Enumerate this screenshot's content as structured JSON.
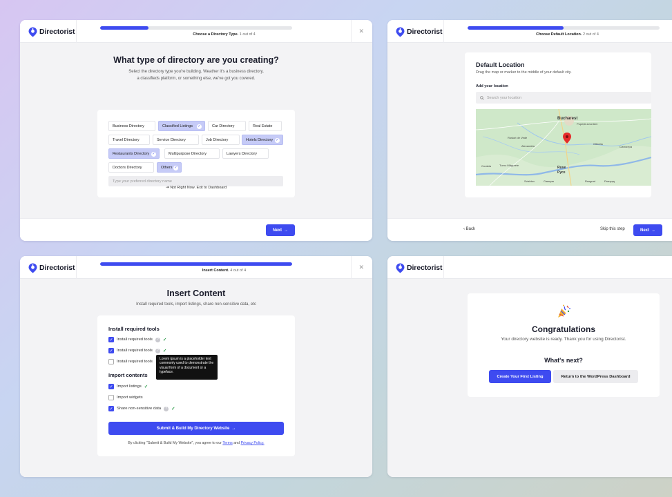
{
  "brand": {
    "name": "Directorist",
    "accent": "#3e4bf0"
  },
  "step1": {
    "progress_fraction": 0.25,
    "step_label": "Choose a Directory Type.",
    "step_count": "1 out of 4",
    "title": "What type of directory are you creating?",
    "subtitle_line1": "Select the directory type you're building. Weather it's a business directory,",
    "subtitle_line2": "a classifieds platform, or something else, we've got you covered.",
    "types": [
      {
        "label": "Business Directory",
        "selected": false
      },
      {
        "label": "Classified Listings",
        "selected": true
      },
      {
        "label": "Car Directory",
        "selected": false
      },
      {
        "label": "Real Estate",
        "selected": false
      },
      {
        "label": "Travel Directory",
        "selected": false
      },
      {
        "label": "Service Directory",
        "selected": false
      },
      {
        "label": "Job Directory",
        "selected": false
      },
      {
        "label": "Hotels Directory",
        "selected": true
      },
      {
        "label": "Restaurants Directory",
        "selected": true
      },
      {
        "label": "Multipurpose Directory",
        "selected": false
      },
      {
        "label": "Lawyers Directory",
        "selected": false
      },
      {
        "label": "Doctors Directory",
        "selected": false
      },
      {
        "label": "Others",
        "selected": true
      }
    ],
    "input_placeholder": "Type your preferred directory name",
    "exit_label": "Not Right Now. Exit to Dashboard",
    "next_label": "Next"
  },
  "step2": {
    "progress_fraction": 0.5,
    "step_label": "Choose Default Location.",
    "step_count": "2 out of 4",
    "card_title": "Default Location",
    "card_subtitle": "Drag the map or marker to the middle of your default city.",
    "add_location_label": "Add your location",
    "search_placeholder": "Search your location",
    "map_labels": {
      "bucharest": "Bucharest",
      "popesti": "Popești-Leordeni",
      "oltenita": "Oltenita",
      "silistra": "Силистра",
      "alexandria": "Alexandria",
      "rosiori": "Rosiori de Vede",
      "ruse": "Ruse",
      "ruse_cyr": "Русе",
      "corabia": "Corabia",
      "turnu": "Turnu Măgurele",
      "razgrad": "Razgrad",
      "razgrad_cyr": "Разград",
      "svishtov": "Svishtov",
      "svishtov_cyr": "Свищов"
    },
    "back_label": "Back",
    "skip_label": "Skip this step",
    "next_label": "Next"
  },
  "step3": {
    "progress_fraction": 1.0,
    "step_label": "Insert Content.",
    "step_count": "4 out of 4",
    "title": "Insert Content",
    "subtitle": "Install required tools, import listings, share non-sensitive data, etc",
    "tools_title": "Install required tools",
    "tools": [
      {
        "label": "Install required tools",
        "checked": true,
        "help": true,
        "done": true
      },
      {
        "label": "Install required tools",
        "checked": true,
        "help": true,
        "done": true
      },
      {
        "label": "Install required tools",
        "checked": false,
        "help": false,
        "done": false
      }
    ],
    "tooltip": "Lorem ipsum is a placeholder text commonly used to demonstrate the visual form of a document or a typeface.",
    "import_title": "Import contents",
    "imports": [
      {
        "label": "Import listings",
        "checked": true,
        "help": false,
        "done": true
      },
      {
        "label": "Import widgets",
        "checked": false,
        "help": false,
        "done": false
      },
      {
        "label": "Share non-sensitive data",
        "checked": true,
        "help": true,
        "done": true
      }
    ],
    "submit_label": "Submit & Build My Directory Website",
    "terms_prefix": "By clicking \"Submit & Build My Website\", you agree to our",
    "terms_link": "Terms",
    "terms_and": "and",
    "privacy_link": "Privacy Policy."
  },
  "step4": {
    "title": "Congratulations",
    "subtitle": "Your directory website is ready. Thank you for using Directorist.",
    "whats_next": "What's next?",
    "create_label": "Create Your First Listing",
    "return_label": "Return to the WordPress Dashboard"
  },
  "icons": {
    "logo": "directorist-logo-icon",
    "close": "close-icon",
    "arrow": "arrow-right-icon",
    "back": "arrow-left-icon",
    "check": "check-icon",
    "search": "search-icon",
    "pin": "map-pin-icon",
    "exit": "exit-icon",
    "party": "party-popper-icon",
    "help": "help-icon"
  }
}
